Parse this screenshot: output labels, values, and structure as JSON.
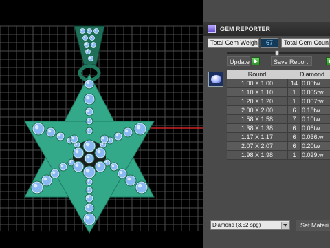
{
  "panel": {
    "title": "GEM REPORTER",
    "total_gem_weight_label": "Total Gem Weight",
    "total_gem_weight_value": "67",
    "total_gem_count_label": "Total Gem Coun",
    "update_label": "Update",
    "save_report_label": "Save Report",
    "columns": {
      "shape": "Round",
      "type": "Diamond"
    },
    "rows": [
      {
        "size": "1.00 X 1.00",
        "count": "14",
        "weight": "0.05tw"
      },
      {
        "size": "1.10 X 1.10",
        "count": "1",
        "weight": "0.005tw"
      },
      {
        "size": "1.20 X 1.20",
        "count": "1",
        "weight": "0.007tw"
      },
      {
        "size": "2.00 X 2.00",
        "count": "6",
        "weight": "0.18tw"
      },
      {
        "size": "1.58 X 1.58",
        "count": "7",
        "weight": "0.10tw"
      },
      {
        "size": "1.38 X 1.38",
        "count": "6",
        "weight": "0.06tw"
      },
      {
        "size": "1.17 X 1.17",
        "count": "6",
        "weight": "0.036tw"
      },
      {
        "size": "2.07 X 2.07",
        "count": "6",
        "weight": "0.20tw"
      },
      {
        "size": "1.98 X 1.98",
        "count": "1",
        "weight": "0.029tw"
      }
    ],
    "material_select": "Diamond    (3.52 spg)",
    "set_material_label": "Set Materi"
  },
  "colors": {
    "metal": "#33a98a",
    "gem": "#8ab8f2",
    "grid": "#4d4d4d",
    "axis": "#cc2222"
  },
  "icons": {
    "title_icon": "gem-reporter-icon",
    "gem_shape_icon": "round-diamond-icon"
  }
}
